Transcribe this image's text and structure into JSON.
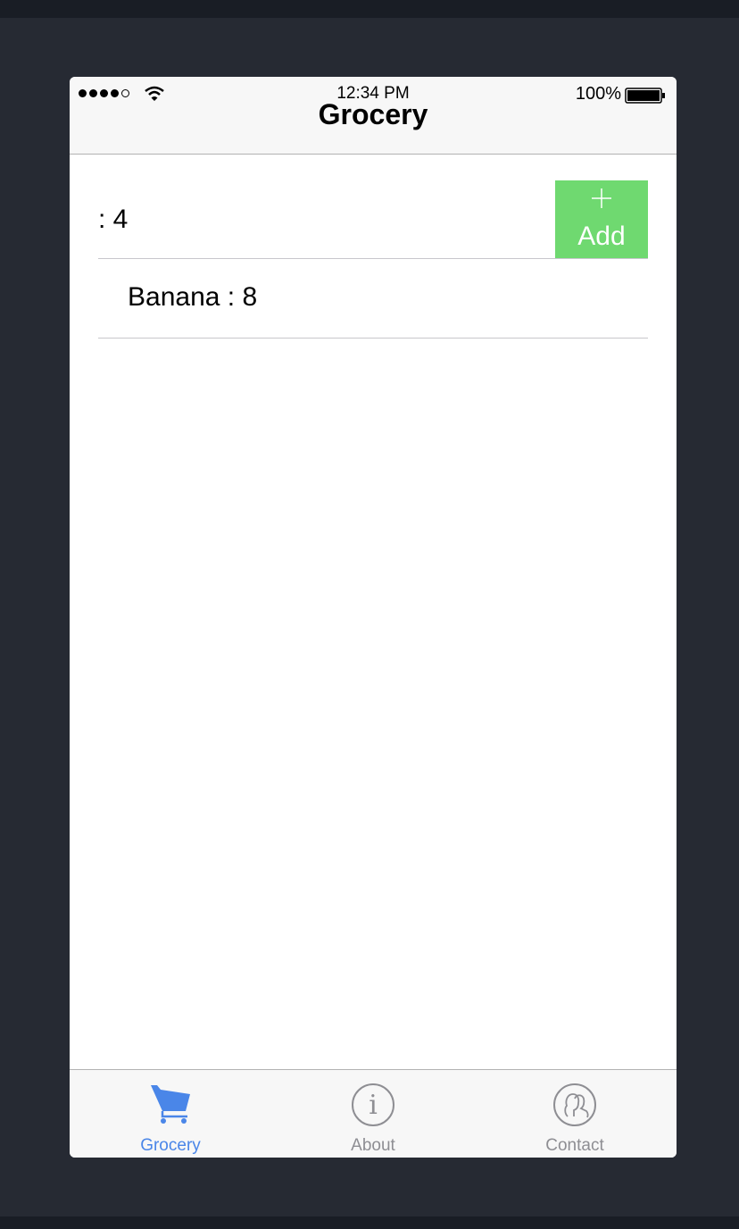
{
  "status_bar": {
    "time": "12:34 PM",
    "battery": "100%"
  },
  "nav": {
    "title": "Grocery"
  },
  "items": [
    {
      "text": ": 4"
    },
    {
      "text": "Banana : 8"
    }
  ],
  "add_button": {
    "label": "Add",
    "icon": "plus-icon",
    "color": "#6fd970"
  },
  "tabs": [
    {
      "label": "Grocery",
      "icon": "cart-icon",
      "active": true
    },
    {
      "label": "About",
      "icon": "info-icon",
      "active": false
    },
    {
      "label": "Contact",
      "icon": "contacts-icon",
      "active": false
    }
  ],
  "colors": {
    "accent": "#4a86e8",
    "tab_inactive": "#8e8e93",
    "background": "#262a33"
  }
}
